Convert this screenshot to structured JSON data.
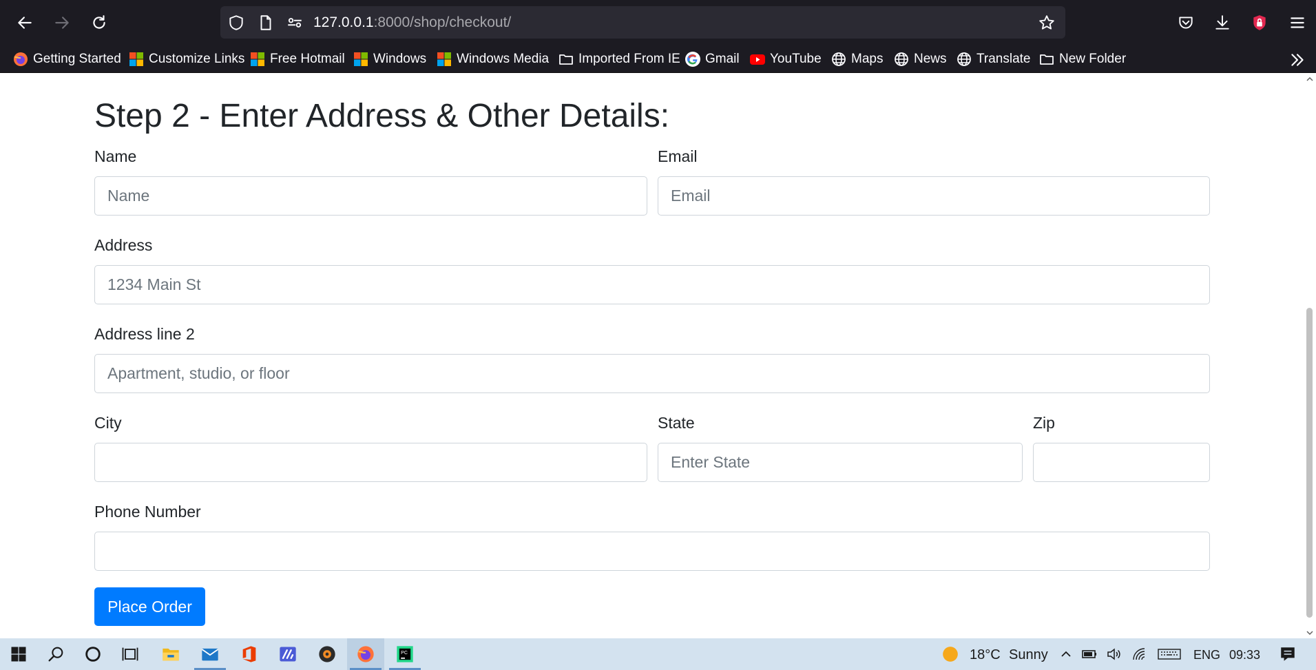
{
  "browser": {
    "url_host": "127.0.0.1",
    "url_path": ":8000/shop/checkout/",
    "bookmarks": [
      {
        "label": "Getting Started",
        "icon": "firefox-icon"
      },
      {
        "label": "Customize Links",
        "icon": "windows-logo-icon"
      },
      {
        "label": "Free Hotmail",
        "icon": "windows-logo-icon"
      },
      {
        "label": "Windows",
        "icon": "windows-logo-icon"
      },
      {
        "label": "Windows Media",
        "icon": "windows-logo-icon"
      },
      {
        "label": "Imported From IE",
        "icon": "folder-icon"
      },
      {
        "label": "Gmail",
        "icon": "google-icon"
      },
      {
        "label": "YouTube",
        "icon": "youtube-icon"
      },
      {
        "label": "Maps",
        "icon": "globe-icon"
      },
      {
        "label": "News",
        "icon": "globe-icon"
      },
      {
        "label": "Translate",
        "icon": "globe-icon"
      },
      {
        "label": "New Folder",
        "icon": "folder-icon"
      }
    ]
  },
  "form": {
    "title": "Step 2 - Enter Address & Other Details:",
    "name": {
      "label": "Name",
      "placeholder": "Name",
      "value": ""
    },
    "email": {
      "label": "Email",
      "placeholder": "Email",
      "value": ""
    },
    "address": {
      "label": "Address",
      "placeholder": "1234 Main St",
      "value": ""
    },
    "address2": {
      "label": "Address line 2",
      "placeholder": "Apartment, studio, or floor",
      "value": ""
    },
    "city": {
      "label": "City",
      "placeholder": "",
      "value": ""
    },
    "state": {
      "label": "State",
      "placeholder": "Enter State",
      "value": ""
    },
    "zip": {
      "label": "Zip",
      "placeholder": "",
      "value": ""
    },
    "phone": {
      "label": "Phone Number",
      "placeholder": "",
      "value": ""
    },
    "submit_label": "Place Order"
  },
  "taskbar": {
    "weather_temp": "18°C",
    "weather_text": "Sunny",
    "language": "ENG",
    "time": "09:33"
  },
  "colors": {
    "browser_chrome": "#1c1b22",
    "urlbar": "#2b2a33",
    "primary_button": "#007bff",
    "taskbar": "#d3e2ef"
  }
}
